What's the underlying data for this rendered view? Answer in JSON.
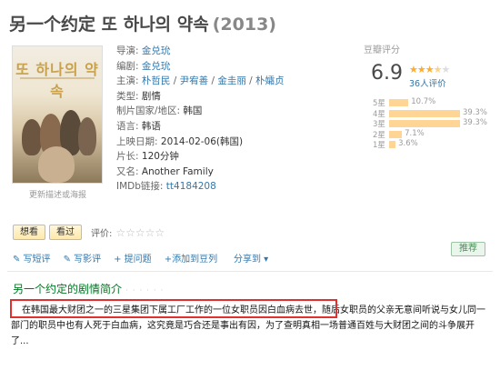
{
  "title": "另一个约定 또 하나의 약속",
  "year": "(2013)",
  "poster": {
    "text": "또 하나의 약속",
    "link": "更新描述或海报"
  },
  "info": {
    "director_label": "导演:",
    "director": "金兑玧",
    "writer_label": "编剧:",
    "writer": "金兑玧",
    "cast_label": "主演:",
    "cast": [
      "朴哲民",
      "尹宥善",
      "金圭丽",
      "朴孀贞"
    ],
    "cast_sep": " / ",
    "genre_label": "类型:",
    "genre": "剧情",
    "country_label": "制片国家/地区:",
    "country": "韩国",
    "language_label": "语言:",
    "language": "韩语",
    "release_label": "上映日期:",
    "release": "2014-02-06(韩国)",
    "runtime_label": "片长:",
    "runtime": "120分钟",
    "aka_label": "又名:",
    "aka": "Another Family",
    "imdb_label": "IMDb链接:",
    "imdb": "tt4184208"
  },
  "rating": {
    "title": "豆瓣评分",
    "score": "6.9",
    "stars_filled": 3.5,
    "votes": "36人评价",
    "bars": [
      {
        "label": "5星",
        "pct": "10.7%",
        "value": 10.7
      },
      {
        "label": "4星",
        "pct": "39.3%",
        "value": 39.3
      },
      {
        "label": "3星",
        "pct": "39.3%",
        "value": 39.3
      },
      {
        "label": "2星",
        "pct": "7.1%",
        "value": 7.1
      },
      {
        "label": "1星",
        "pct": "3.6%",
        "value": 3.6
      }
    ]
  },
  "buttons": {
    "want": "想看",
    "seen": "看过",
    "rate_label": "评价:",
    "empty_stars": "☆☆☆☆☆"
  },
  "actions": {
    "short_review": "✎ 写短评",
    "review": "✎ 写影评",
    "ask": "+ 提问题",
    "add_list": "+添加到豆列",
    "share": "分享到 ▾",
    "recommend": "推荐"
  },
  "summary": {
    "heading": "另一个约定的剧情简介",
    "dots": "· · · · · ·",
    "text": "在韩国最大财团之一的三星集团下属工厂工作的一位女职员因白血病去世，随后女职员的父亲无意间听说与女儿同一部门的职员中也有人死于白血病，这究竟是巧合还是事出有因，为了查明真相一场普通百姓与大财团之间的斗争展开了..."
  },
  "colors": {
    "link": "#37a",
    "heading_green": "#072",
    "highlight_red": "#e03030",
    "bar_fill": "#ffd596",
    "star": "#ffac2d"
  }
}
